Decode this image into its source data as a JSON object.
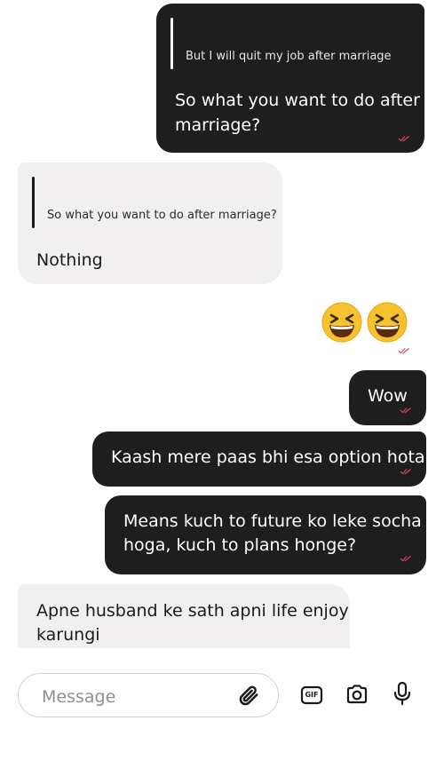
{
  "messages": [
    {
      "direction": "outgoing",
      "reply_to": "But I will quit my job after marriage",
      "lines": [
        "So what you want to do after",
        "marriage?"
      ],
      "read": true
    },
    {
      "direction": "incoming",
      "reply_to": "So what you want to do after marriage?",
      "lines": [
        "Nothing"
      ]
    },
    {
      "direction": "outgoing",
      "emoji": [
        "grinning-squinting-face",
        "grinning-squinting-face"
      ],
      "read": true
    },
    {
      "direction": "outgoing",
      "lines": [
        "Wow"
      ],
      "read": true
    },
    {
      "direction": "outgoing",
      "lines": [
        "Kaash mere paas bhi esa option hota"
      ],
      "read": true
    },
    {
      "direction": "outgoing",
      "lines": [
        "Means kuch to future ko leke socha",
        "hoga, kuch to plans honge?"
      ],
      "read": true
    },
    {
      "direction": "incoming",
      "lines": [
        "Apne husband ke sath apni life enjoy",
        "karungi"
      ]
    }
  ],
  "composer": {
    "placeholder": "Message",
    "icons": [
      "paperclip-icon",
      "gif-icon",
      "camera-icon",
      "microphone-icon"
    ],
    "gif_label": "GIF"
  },
  "colors": {
    "outgoing_bubble": "#1e1e1e",
    "incoming_bubble": "#f2eff0",
    "read_tick": "#e0435c"
  }
}
